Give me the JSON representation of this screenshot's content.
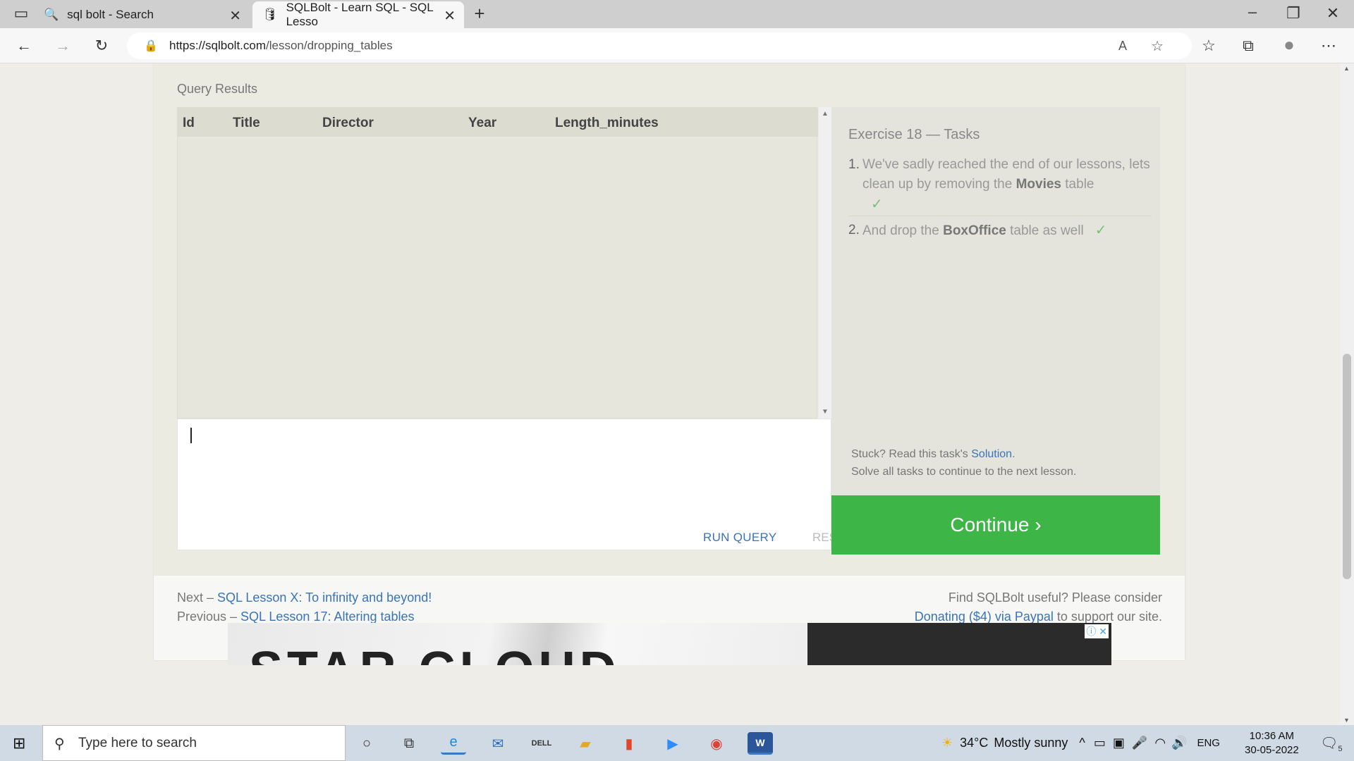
{
  "browser": {
    "tabs": [
      {
        "title": "sql bolt - Search",
        "active": false
      },
      {
        "title": "SQLBolt - Learn SQL - SQL Lesso",
        "active": true
      }
    ],
    "url_host": "https://sqlbolt.com",
    "url_path": "/lesson/dropping_tables"
  },
  "exercise": {
    "results_label": "Query Results",
    "columns": [
      "Id",
      "Title",
      "Director",
      "Year",
      "Length_minutes"
    ],
    "editor_value": "",
    "run_label": "RUN QUERY",
    "reset_label": "RESET",
    "tasks_title": "Exercise 18 — Tasks",
    "tasks": [
      {
        "num": "1.",
        "pre": "We've sadly reached the end of our lessons, lets clean up by removing the ",
        "bold": "Movies",
        "post": " table",
        "check": "✓"
      },
      {
        "num": "2.",
        "pre": "And drop the ",
        "bold": "BoxOffice",
        "post": " table as well",
        "check": "✓"
      }
    ],
    "stuck_text": "Stuck? Read this task's ",
    "solution_link": "Solution",
    "stuck_end": ".",
    "solve_all_text": "Solve all tasks to continue to the next lesson.",
    "continue_label": "Continue ›",
    "accent_color": "#3db547"
  },
  "footer": {
    "next_prefix": "Next – ",
    "next_link": "SQL Lesson X: To infinity and beyond!",
    "prev_prefix": "Previous – ",
    "prev_link": "SQL Lesson 17: Altering tables",
    "donate_text": "Find SQLBolt useful? Please consider",
    "donate_link": "Donating ($4) via Paypal",
    "donate_end": " to support our site."
  },
  "ad": {
    "text": "STAR CLOUD"
  },
  "taskbar": {
    "search_placeholder": "Type here to search",
    "weather_temp": "34°C",
    "weather_desc": "Mostly sunny",
    "lang": "ENG",
    "time": "10:36 AM",
    "date": "30-05-2022",
    "notif_count": "5"
  }
}
